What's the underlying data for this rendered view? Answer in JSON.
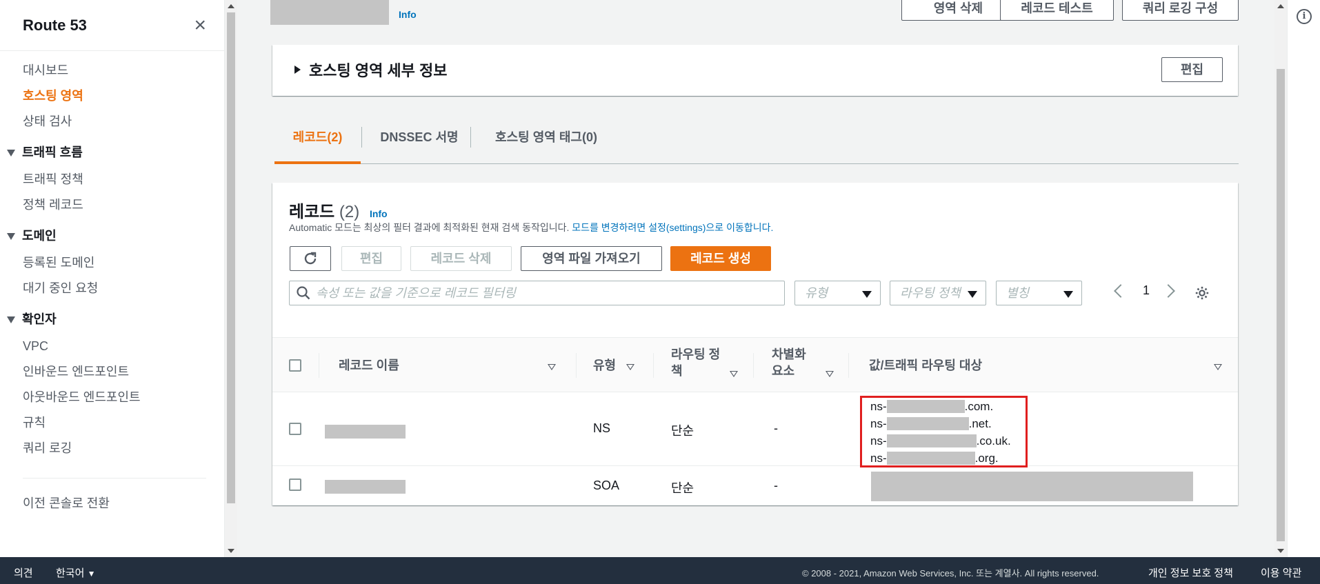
{
  "sidebar": {
    "title": "Route 53",
    "items_top": [
      "대시보드",
      "호스팅 영역",
      "상태 검사"
    ],
    "sections": [
      {
        "label": "트래픽 흐름",
        "items": [
          "트래픽 정책",
          "정책 레코드"
        ]
      },
      {
        "label": "도메인",
        "items": [
          "등록된 도메인",
          "대기 중인 요청"
        ]
      },
      {
        "label": "확인자",
        "items": [
          "VPC",
          "인바운드 엔드포인트",
          "아웃바운드 엔드포인트",
          "규칙",
          "쿼리 로깅"
        ]
      }
    ],
    "legacy": "이전 콘솔로 전환"
  },
  "header": {
    "info": "Info",
    "buttons": [
      "영역 삭제",
      "레코드 테스트",
      "쿼리 로깅 구성"
    ]
  },
  "details": {
    "title": "호스팅 영역 세부 정보",
    "edit": "편집"
  },
  "tabs": [
    "레코드(2)",
    "DNSSEC 서명",
    "호스팅 영역 태그(0)"
  ],
  "records": {
    "title": "레코드",
    "count": "(2)",
    "info": "Info",
    "desc": "Automatic 모드는 최상의 필터 결과에 최적화된 현재 검색 동작입니다.",
    "desc_link": "모드를 변경하려면 설정(settings)으로 이동합니다.",
    "buttons": {
      "edit": "편집",
      "delete": "레코드 삭제",
      "import": "영역 파일 가져오기",
      "create": "레코드 생성"
    },
    "search_placeholder": "속성 또는 값을 기준으로 레코드 필터링",
    "filters": {
      "type": "유형",
      "routing": "라우팅 정책",
      "alias": "별칭"
    },
    "page": "1",
    "columns": {
      "name": "레코드 이름",
      "type": "유형",
      "routing_1": "라우팅 정",
      "routing_2": "책",
      "diff_1": "차별화",
      "diff_2": "요소",
      "value": "값/트래픽 라우팅 대상"
    },
    "rows": [
      {
        "type": "NS",
        "routing": "단순",
        "diff": "-",
        "values": [
          {
            "prefix": "ns-",
            "suffix": ".com."
          },
          {
            "prefix": "ns-",
            "suffix": ".net."
          },
          {
            "prefix": "ns-",
            "suffix": ".co.uk."
          },
          {
            "prefix": "ns-",
            "suffix": ".org."
          }
        ]
      },
      {
        "type": "SOA",
        "routing": "단순",
        "diff": "-"
      }
    ]
  },
  "footer": {
    "feedback": "의견",
    "language": "한국어",
    "copyright": "© 2008 - 2021, Amazon Web Services, Inc. 또는 계열사. All rights reserved.",
    "privacy": "개인 정보 보호 정책",
    "terms": "이용 약관"
  },
  "colors": {
    "accent": "#ec7211",
    "link": "#0073bb",
    "footer": "#232f3e",
    "highlight": "#e01f1f"
  }
}
